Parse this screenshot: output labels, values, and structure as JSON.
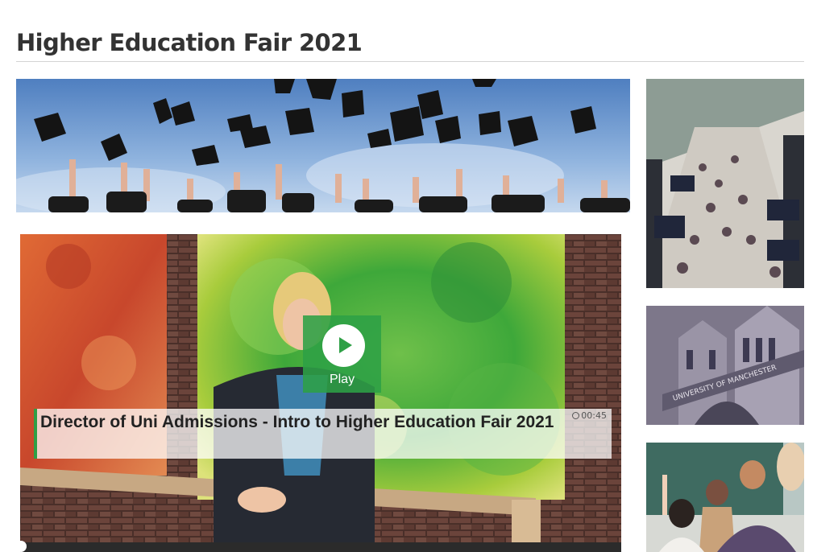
{
  "page": {
    "title": "Higher Education Fair 2021"
  },
  "banner": {
    "image": "graduates-throwing-caps"
  },
  "video": {
    "title": "Director of Uni Admissions - Intro to Higher Education Fair 2021",
    "duration": "00:45",
    "play_label": "Play",
    "progress": 0,
    "accent_color": "#2ea046"
  },
  "thumbnails": [
    {
      "image": "education-fair-hall-aerial"
    },
    {
      "image": "university-of-manchester-building"
    },
    {
      "image": "classroom-students-raising-hands"
    }
  ],
  "building_sign": "UNIVERSITY OF MANCHESTER",
  "icons": {
    "play": "play-icon",
    "duration": "clock-icon"
  }
}
